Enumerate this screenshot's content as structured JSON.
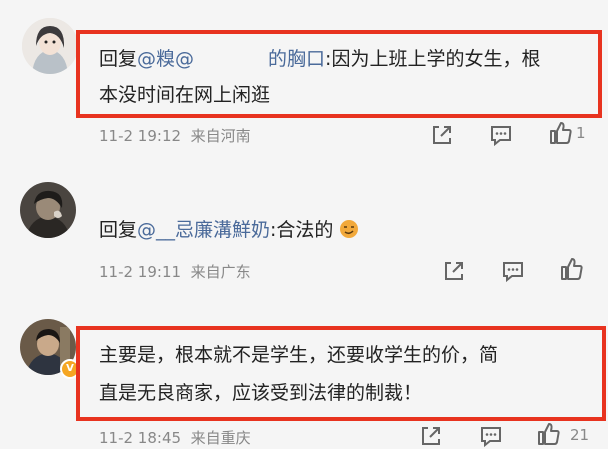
{
  "comments": [
    {
      "reply_prefix": "回复",
      "mention": "@糗@",
      "mention_tail": "的胸口",
      "text_line1": ":因为上班上学的女生，根",
      "text_line2": "本没时间在网上闲逛",
      "time": "11-2 19:12",
      "location": "来自河南",
      "likes": "1"
    },
    {
      "reply_prefix": "回复",
      "mention": "@__忌廉溝鮮奶",
      "text": ":合法的",
      "time": "11-2 19:11",
      "location": "来自广东",
      "likes": ""
    },
    {
      "text_line1": "主要是，根本就不是学生，还要收学生的价，简",
      "text_line2": "直是无良商家，应该受到法律的制裁！",
      "time": "11-2 18:45",
      "location": "来自重庆",
      "likes": "21"
    }
  ],
  "colors": {
    "highlight_box": "#e8331f",
    "mention": "#4a6a9a",
    "meta": "#888888",
    "verified_badge": "#f5a623"
  },
  "icons": [
    "share-icon",
    "comment-icon",
    "like-icon",
    "verified-badge-icon",
    "smirk-emoji-icon"
  ]
}
